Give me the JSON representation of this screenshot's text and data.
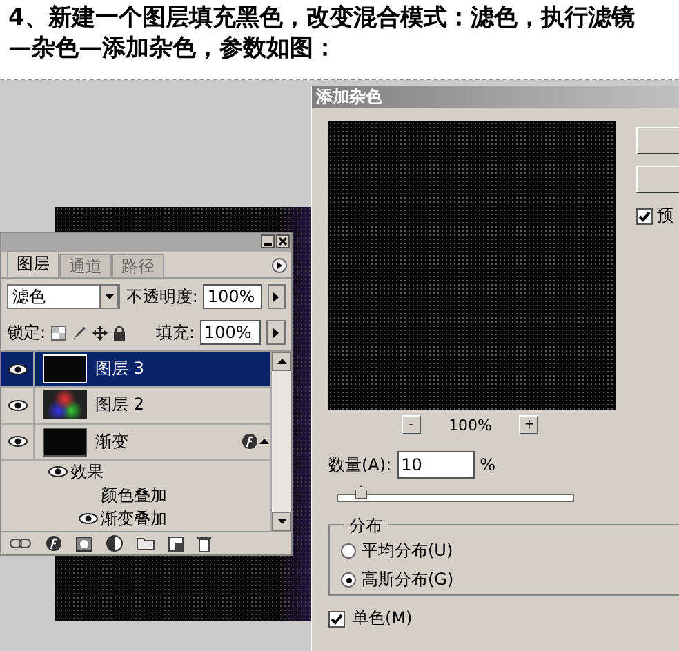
{
  "heading": "4、新建一个图层填充黑色，改变混合模式：滤色，执行滤镜—杂色—添加杂色，参数如图：",
  "layers_panel": {
    "tabs": [
      {
        "label": "图层",
        "selected": true
      },
      {
        "label": "通道",
        "selected": false
      },
      {
        "label": "路径",
        "selected": false
      }
    ],
    "blend_mode": "滤色",
    "opacity_label": "不透明度:",
    "opacity": "100%",
    "lock_label": "锁定:",
    "fill_label": "填充:",
    "fill": "100%",
    "layers": [
      {
        "name": "图层 3",
        "selected": true,
        "visible": true,
        "kind": "dark"
      },
      {
        "name": "图层 2",
        "selected": false,
        "visible": true,
        "kind": "color"
      },
      {
        "name": "渐变",
        "selected": false,
        "visible": true,
        "kind": "dark",
        "effects": {
          "label": "效果",
          "visible": true,
          "children": [
            {
              "name": "颜色叠加",
              "visible": false
            },
            {
              "name": "渐变叠加",
              "visible": true
            }
          ]
        }
      }
    ]
  },
  "dialog": {
    "title": "添加杂色",
    "preview": {
      "label": "预",
      "checked": true
    },
    "zoom": {
      "minus": "-",
      "value": "100%",
      "plus": "+"
    },
    "amount": {
      "label": "数量(A):",
      "value": "10",
      "unit": "%",
      "level": 0.1
    },
    "distribution": {
      "title": "分布",
      "options": [
        {
          "label": "平均分布(U)",
          "selected": false
        },
        {
          "label": "高斯分布(G)",
          "selected": true
        }
      ]
    },
    "monochromatic": {
      "label": "单色(M)",
      "checked": true
    }
  }
}
